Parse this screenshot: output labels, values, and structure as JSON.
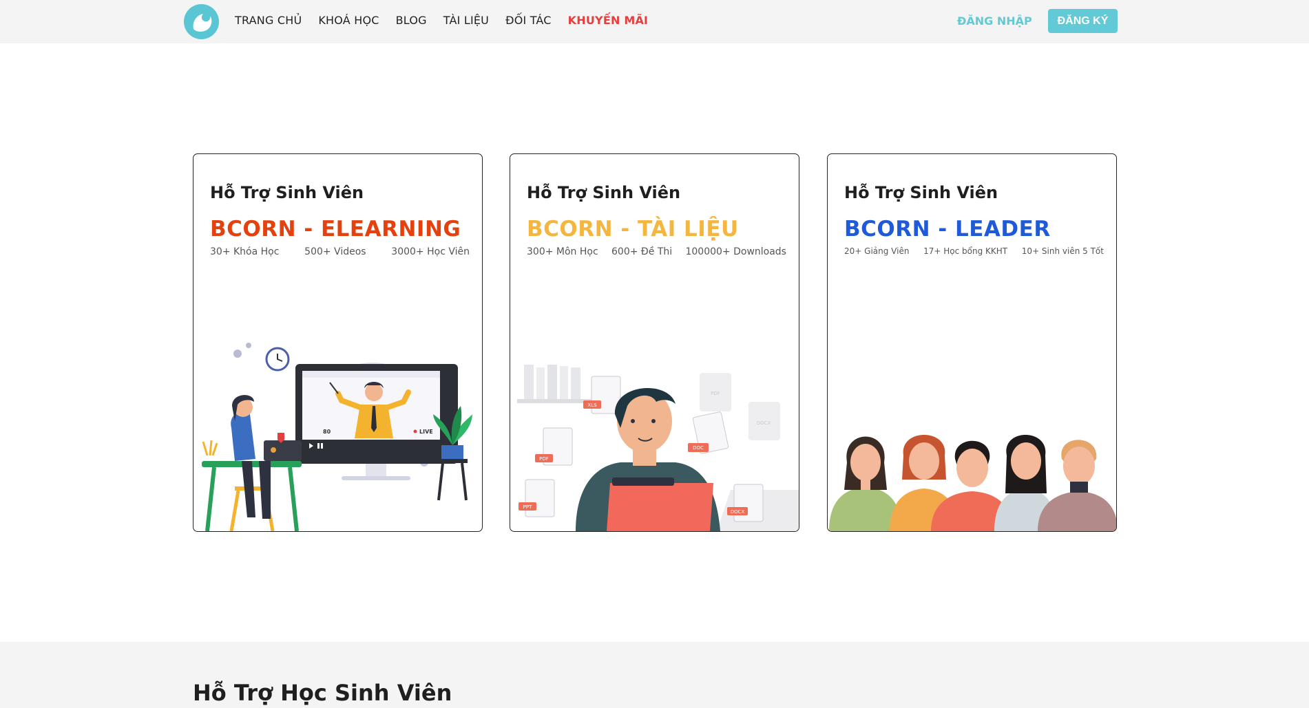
{
  "header": {
    "nav": [
      "TRANG CHỦ",
      "KHOÁ HỌC",
      "BLOG",
      "TÀI LIỆU",
      "ĐỐI TÁC",
      "KHUYẾN MÃI"
    ],
    "login_label": "ĐĂNG NHẬP",
    "signup_label": "ĐĂNG KÝ"
  },
  "cards": [
    {
      "subtitle": "Hỗ Trợ Sinh Viên",
      "title": "BCORN - ELEARNING",
      "title_color": "#e4410f",
      "stats": [
        "30+ Khóa Học",
        "500+ Videos",
        "3000+ Học Viên"
      ]
    },
    {
      "subtitle": "Hỗ Trợ Sinh Viên",
      "title": "BCORN - TÀI LIỆU",
      "title_color": "#f4b63f",
      "stats": [
        "300+ Môn Học",
        "600+ Đề Thi",
        "100000+ Downloads"
      ]
    },
    {
      "subtitle": "Hỗ Trợ Sinh Viên",
      "title": "BCORN - LEADER",
      "title_color": "#1f5bd8",
      "stats": [
        "20+ Giảng Viên",
        "17+ Học bổng KKHT",
        "10+ Sinh viên 5 Tốt"
      ]
    }
  ],
  "illustrations": {
    "elearning": {
      "live_label": "LIVE",
      "viewer_count": "80"
    },
    "documents": {
      "file_tags": [
        "XLS",
        "PDF",
        "DOC",
        "PPT",
        "DOCX",
        "PDF",
        "DOCX"
      ]
    }
  },
  "section": {
    "heading": "Hỗ Trợ Học Sinh Viên"
  },
  "colors": {
    "accent": "#62c9d6",
    "promo": "#e53e3e",
    "header_bg": "#f4f4f5"
  }
}
